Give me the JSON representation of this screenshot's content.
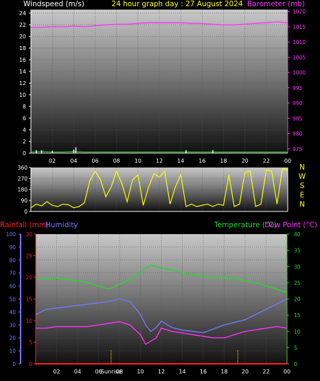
{
  "title": "24 hour graph day : 27 August 2024",
  "colors": {
    "wind": "#f0f0f0",
    "pressure": "#ff33ff",
    "direction": "#ffff00",
    "rain": "#ff2020",
    "humidity": "#7777ff",
    "temperature": "#22dd22",
    "dewpoint": "#ff33ff",
    "sunline": "#ffff00",
    "title": "#ffff00"
  },
  "time_ticks": [
    "02",
    "04",
    "06",
    "08",
    "10",
    "12",
    "14",
    "16",
    "18",
    "20",
    "22",
    "00"
  ],
  "sunrise_label": "Sunrise",
  "chart_data": [
    {
      "type": "line",
      "id": "wind_pressure",
      "left_label": "Windspeed (m/s)",
      "right_label": "Barometer (mb)",
      "left_ticks": [
        "0",
        "2",
        "4",
        "6",
        "8",
        "10",
        "12",
        "14",
        "16",
        "18",
        "20",
        "22",
        "24"
      ],
      "right_ticks": [
        "975",
        "980",
        "985",
        "990",
        "995",
        "1000",
        "1005",
        "1010",
        "1015",
        "1020"
      ],
      "ylim_left": [
        0,
        24.6
      ],
      "ylim_right": [
        973.6,
        1020.6
      ],
      "x_hours": [
        0,
        1,
        2,
        3,
        4,
        5,
        6,
        7,
        8,
        9,
        10,
        11,
        12,
        13,
        14,
        15,
        16,
        17,
        18,
        19,
        20,
        21,
        22,
        23,
        24
      ],
      "series": [
        {
          "name": "Barometer",
          "axis": "right",
          "values": [
            1014.8,
            1014.8,
            1015.0,
            1015.0,
            1015.2,
            1015.0,
            1015.3,
            1015.6,
            1015.8,
            1015.8,
            1016.1,
            1016.3,
            1016.3,
            1016.3,
            1016.3,
            1016.1,
            1016.0,
            1015.8,
            1015.6,
            1015.6,
            1015.8,
            1016.1,
            1016.3,
            1016.6,
            1016.3
          ]
        },
        {
          "name": "Windspeed",
          "axis": "left",
          "values": [
            0.2,
            0.3,
            0.2,
            0.2,
            0.3,
            0.2,
            0.2,
            0.2,
            0.2,
            0.2,
            0.2,
            0.2,
            0.2,
            0.2,
            0.2,
            0.2,
            0.2,
            0.2,
            0.2,
            0.2,
            0.2,
            0.2,
            0.2,
            0.2,
            0.2
          ]
        },
        {
          "name": "Gusts",
          "axis": "left",
          "x_hours": [
            0.5,
            1,
            2,
            4,
            4.2,
            14.5,
            17
          ],
          "values": [
            0.5,
            0.5,
            0.4,
            0.6,
            1.0,
            0.5,
            0.5
          ]
        }
      ]
    },
    {
      "type": "line",
      "id": "direction",
      "left_ticks": [
        "0",
        "90",
        "180",
        "270",
        "360"
      ],
      "right_labels": [
        "N",
        "W",
        "S",
        "E",
        "N"
      ],
      "ylim": [
        0,
        360
      ],
      "x_hours": [
        0,
        0.5,
        1,
        1.5,
        2,
        2.5,
        3,
        3.5,
        4,
        4.5,
        5,
        5.5,
        6,
        6.5,
        7,
        7.5,
        8,
        8.5,
        9,
        9.5,
        10,
        10.5,
        11,
        11.5,
        12,
        12.5,
        13,
        13.5,
        14,
        14.5,
        15,
        15.5,
        16,
        16.5,
        17,
        17.5,
        18,
        18.5,
        19,
        19.5,
        20,
        20.5,
        21,
        21.5,
        22,
        22.5,
        23,
        23.5,
        24
      ],
      "series": [
        {
          "name": "Wind direction",
          "values": [
            30,
            60,
            45,
            80,
            50,
            40,
            60,
            55,
            30,
            40,
            70,
            250,
            330,
            260,
            120,
            200,
            330,
            230,
            80,
            260,
            300,
            50,
            200,
            310,
            280,
            330,
            60,
            200,
            300,
            40,
            60,
            40,
            50,
            60,
            40,
            60,
            50,
            300,
            40,
            60,
            320,
            330,
            40,
            60,
            340,
            330,
            60,
            350,
            340
          ]
        }
      ]
    },
    {
      "type": "line",
      "id": "rain_humidity_temp",
      "left_label_rain": "Rainfall (mm)",
      "left_label_hum": "Humidity",
      "right_label_temp": "Temperature (°C)",
      "right_label_dew": "Dew Point (°C)",
      "hum_ticks": [
        "0",
        "10",
        "20",
        "30",
        "40",
        "50",
        "60",
        "70",
        "80",
        "90",
        "100"
      ],
      "rain_ticks": [
        "0",
        "5",
        "10",
        "15",
        "20",
        "25",
        "30"
      ],
      "temp_ticks": [
        "0",
        "5",
        "10",
        "15",
        "20",
        "25",
        "30",
        "35",
        "40"
      ],
      "ylim_hum": [
        0,
        100
      ],
      "ylim_rain": [
        0,
        30
      ],
      "ylim_temp": [
        0,
        40
      ],
      "x_hours": [
        0,
        1,
        2,
        3,
        4,
        5,
        6,
        7,
        8,
        9,
        10,
        10.5,
        11,
        11.5,
        12,
        13,
        14,
        15,
        16,
        17,
        18,
        19,
        20,
        21,
        22,
        23,
        24
      ],
      "series": [
        {
          "name": "Temperature",
          "axis": "temp",
          "values": [
            26.5,
            26,
            26.5,
            26,
            25.5,
            25,
            24,
            23,
            24.5,
            26,
            28,
            29.5,
            30.5,
            30,
            29.5,
            29,
            28,
            27.5,
            27,
            26.5,
            26.5,
            26.5,
            25.5,
            25,
            24,
            23,
            22
          ]
        },
        {
          "name": "Humidity",
          "axis": "hum",
          "values": [
            38,
            42,
            43,
            44,
            45,
            46,
            47,
            48,
            50,
            48,
            38,
            30,
            25,
            28,
            33,
            28,
            26,
            25,
            24,
            27,
            30,
            32,
            34,
            38,
            42,
            46,
            50
          ]
        },
        {
          "name": "Dew Point",
          "axis": "temp",
          "values": [
            11,
            11,
            11.5,
            11.5,
            11.5,
            11.5,
            12,
            12.5,
            13,
            12,
            9,
            6,
            7,
            8,
            11,
            10,
            9.5,
            9,
            8.5,
            8,
            8,
            9,
            10,
            10.5,
            11,
            11.5,
            11
          ]
        },
        {
          "name": "Rainfall",
          "axis": "rain",
          "values": [
            0,
            0,
            0,
            0,
            0,
            0,
            0,
            0,
            0,
            0,
            0,
            0,
            0,
            0,
            0,
            0,
            0,
            0,
            0,
            0,
            0,
            0,
            0,
            0,
            0,
            0,
            0
          ]
        }
      ],
      "sun_lines_hours": [
        7.2,
        19.3
      ]
    }
  ]
}
